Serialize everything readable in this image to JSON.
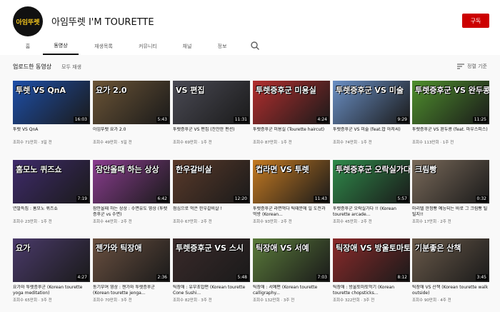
{
  "channel": {
    "avatar_text": "아임뚜렛",
    "name": "아임뚜렛 I'M TOURETTE",
    "subscribe_label": "구독"
  },
  "tabs": [
    {
      "label": "홈",
      "active": false
    },
    {
      "label": "동영상",
      "active": true
    },
    {
      "label": "재생목록",
      "active": false
    },
    {
      "label": "커뮤니티",
      "active": false
    },
    {
      "label": "채널",
      "active": false
    },
    {
      "label": "정보",
      "active": false
    }
  ],
  "section": {
    "title": "업로드한 동영상",
    "play_all": "모두 재생",
    "sort_label": "정렬 기준"
  },
  "colors": {
    "brand_red": "#cc0000",
    "accent": "#f2c51d"
  },
  "videos": [
    {
      "thumb_text": "투렛 VS QnA",
      "duration": "16:03",
      "title": "투렛 VS QnA",
      "meta": "조회수 71만회 · 3일 전",
      "bg": "#1e4fa8"
    },
    {
      "thumb_text": "요가 2.0",
      "duration": "5:43",
      "title": "아임뚜렛 요가 2.0",
      "meta": "조회수 49만회 · 5일 전",
      "bg": "#6b5436"
    },
    {
      "thumb_text": "VS 편집",
      "duration": "11:31",
      "title": "투렛증후군 VS 편집 (잔잔한 편션)",
      "meta": "조회수 69만회 · 1주 전",
      "bg": "#4a4a54"
    },
    {
      "thumb_text": "투렛증후군 미용실",
      "duration": "4:24",
      "title": "투렛증후군 미용실 (Tourette haircut)",
      "meta": "조회수 87만회 · 1주 전",
      "bg": "#b22e2e"
    },
    {
      "thumb_text": "투렛증후군 VS 미술",
      "duration": "9:29",
      "title": "투렛증후군 VS 미술 (feat.밥 아저씨)",
      "meta": "조회수 74만회 · 1주 전",
      "bg": "#6a8fc4"
    },
    {
      "thumb_text": "투렛증후군 VS 완두콩",
      "duration": "11:25",
      "title": "투렛증후군 VS 완두콩 (feat. 마우스피스)",
      "meta": "조회수 113만회 · 1주 전",
      "bg": "#4f8f2d"
    },
    {
      "thumb_text": "홈모노 퀴즈쇼",
      "duration": "7:19",
      "title": "연말특집 : 홈모노 퀴즈쇼",
      "meta": "조회수 23만회 · 1주 전",
      "bg": "#3f2b6b"
    },
    {
      "thumb_text": "잠안올때 하는 상상",
      "duration": "6:42",
      "title": "잠안올때 하는 상상 : 수면유도 영상 (투렛증후군 vs 수면)",
      "meta": "조회수 44만회 · 2주 전",
      "bg": "#8a3d8f"
    },
    {
      "thumb_text": "한우갈비살",
      "duration": "12:20",
      "title": "점심으로 먹은 한우갈비살 !",
      "meta": "조회수 67만회 · 2주 전",
      "bg": "#5a3a2a"
    },
    {
      "thumb_text": "컵라면 VS 투렛",
      "duration": "11:43",
      "title": "투렛증후군 라면먹다 틱때문에 일 도전과 먹방 (Korean...",
      "meta": "조회수 93만회 · 2주 전",
      "bg": "#c47a22"
    },
    {
      "thumb_text": "투렛증후군 오락실가다",
      "duration": "5:57",
      "title": "투렛증후군 오락실가다 !! (Korean tourette arcade...",
      "meta": "조회수 45만회 · 2주 전",
      "bg": "#2f8a4a"
    },
    {
      "thumb_text": "크림빵",
      "duration": "0:32",
      "title": "마리텔 한정빵 예능되는 바로 그 크림빵 틸틸지!!",
      "meta": "조회수 17만회 · 2주 전",
      "bg": "#7a6a5a"
    },
    {
      "thumb_text": "요가",
      "duration": "4:27",
      "title": "요가와 투렛증후군 (Korean tourette yoga meditation)",
      "meta": "조회수 65만회 · 3주 전",
      "bg": "#4a3a6a"
    },
    {
      "thumb_text": "젠가와 틱장애",
      "duration": "2:36",
      "title": "동기부여 영상 : 젠가와 투렛증후군 (Korean tourette jenga...",
      "meta": "조회수 70만회 · 3주 전",
      "bg": "#6a5040"
    },
    {
      "thumb_text": "투렛증후군 VS 스시",
      "duration": "5:48",
      "title": "틱장애 : 유부초밥편 (Korean tourette Cone Sushi...",
      "meta": "조회수 82만회 · 3주 전",
      "bg": "#3a2a2a"
    },
    {
      "thumb_text": "틱장애 VS 서예",
      "duration": "7:03",
      "title": "틱장애 : 서예편 (Korean tourette calligraphy...",
      "meta": "조회수 132만회 · 3주 전",
      "bg": "#5a7a3a"
    },
    {
      "thumb_text": "틱장애 VS 방울토마토",
      "duration": "8:12",
      "title": "틱장애 : 방울토마토먹기 (Korean tourette chopsticks...",
      "meta": "조회수 322만회 · 3주 전",
      "bg": "#8a2a2a"
    },
    {
      "thumb_text": "기분좋은 산책",
      "duration": "3:45",
      "title": "틱장애 VS 산책 (Korean tourette walk outside)",
      "meta": "조회수 90만회 · 4주 전",
      "bg": "#6a5a4a"
    }
  ]
}
